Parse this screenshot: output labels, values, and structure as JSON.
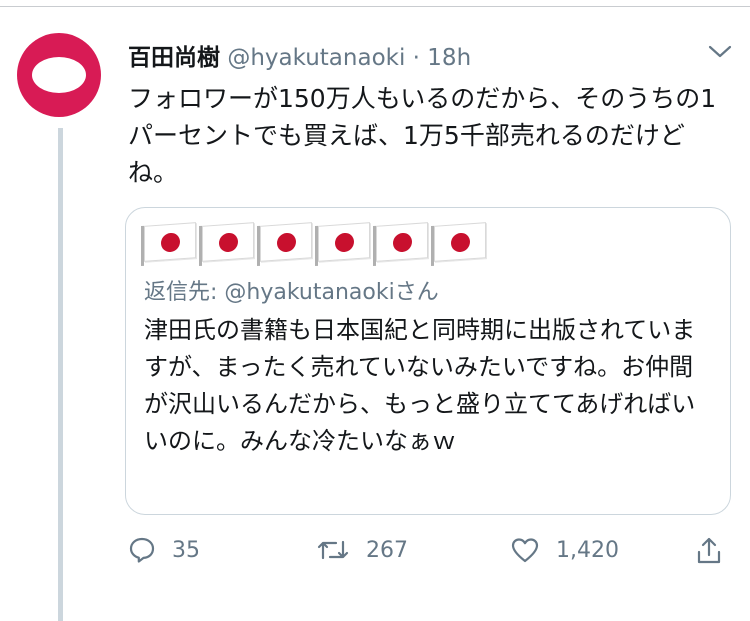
{
  "tweet": {
    "name": "百田尚樹",
    "handle": "@hyakutanaoki",
    "separator": "·",
    "time": "18h",
    "text": "フォロワーが150万人もいるのだから、そのうちの1パーセントでも買えば、1万5千部売れるのだけどね。"
  },
  "quoted": {
    "flag_count": 6,
    "flag_icon": "japan-flag-emoji",
    "replying_to": "返信先: @hyakutanaokiさん",
    "text": "津田氏の書籍も日本国紀と同時期に出版されていますが、まったく売れていないみたいですね。お仲間が沢山いるんだから、もっと盛り立ててあげればいいのに。みんな冷たいなぁｗ"
  },
  "actions": {
    "reply_count": "35",
    "retweet_count": "267",
    "like_count": "1,420"
  },
  "colors": {
    "avatar": "#d81b55",
    "muted": "#657786",
    "border": "#ccd6dd",
    "flag_red": "#c8102e"
  }
}
